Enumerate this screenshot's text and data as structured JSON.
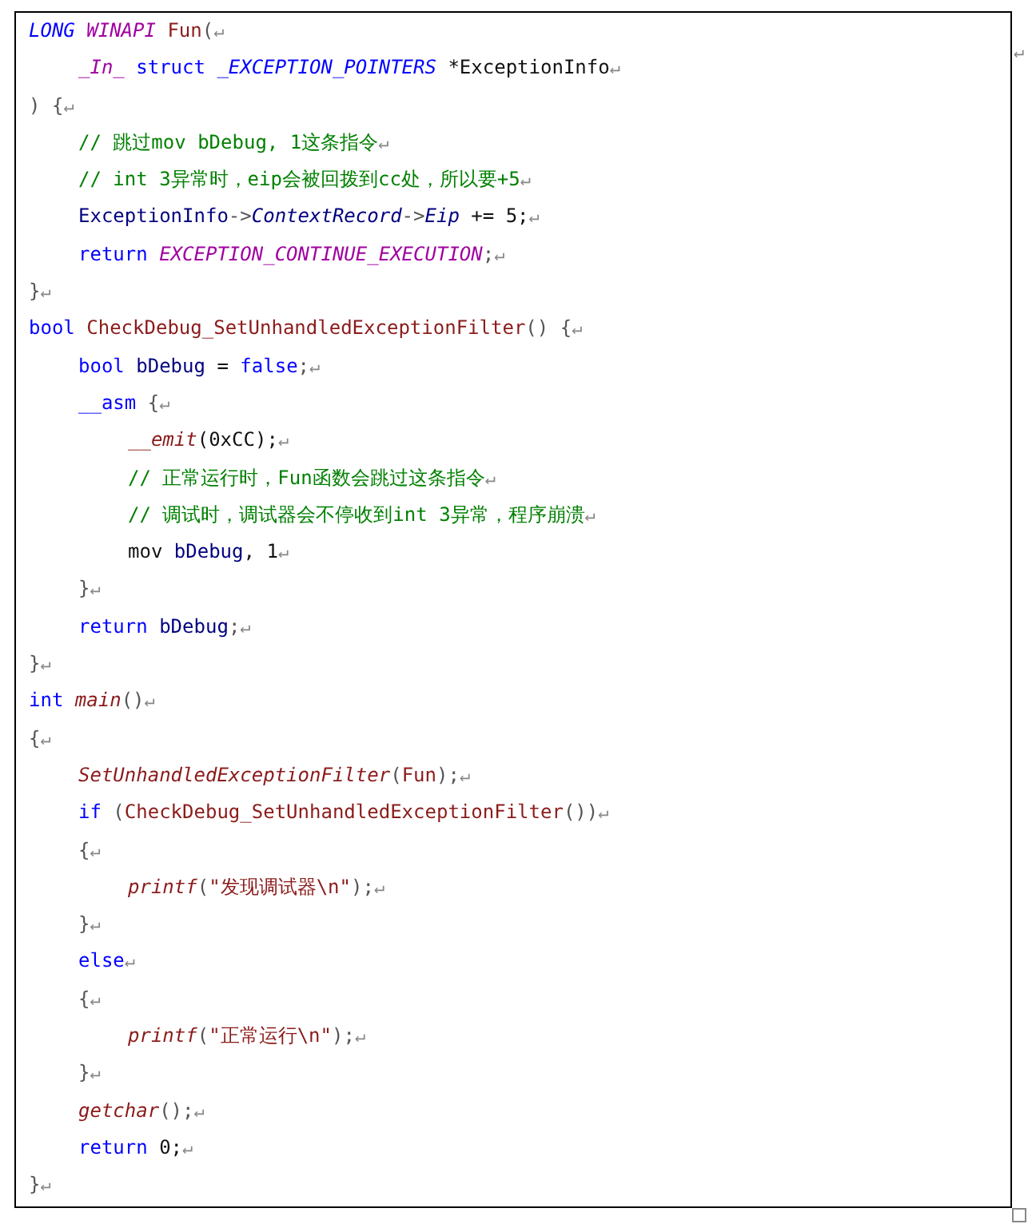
{
  "margin_mark": "↵",
  "code_block": {
    "lines": [
      {
        "tokens": [
          {
            "kind": "type",
            "text": "LONG "
          },
          {
            "kind": "macro",
            "text": "WINAPI "
          },
          {
            "kind": "func",
            "text": "Fun"
          },
          {
            "kind": "punct",
            "text": "("
          }
        ],
        "end": "↵",
        "children": [
          {
            "tokens": [
              {
                "kind": "macro",
                "text": "_In_"
              },
              {
                "kind": "keyword",
                "text": " struct"
              },
              {
                "kind": "type",
                "text": " _EXCEPTION_POINTERS"
              },
              {
                "kind": "plain",
                "text": " *ExceptionInfo"
              }
            ],
            "end": "↵"
          }
        ]
      },
      {
        "tokens": [
          {
            "kind": "punct",
            "text": ") {"
          }
        ],
        "end": "↵",
        "children": [
          {
            "tokens": [
              {
                "kind": "comment",
                "text": "// 跳过mov bDebug, 1这条指令"
              }
            ],
            "end": "↵"
          },
          {
            "tokens": [
              {
                "kind": "comment",
                "text": "// int 3异常时，eip会被回拨到cc处，所以要+5"
              }
            ],
            "end": "↵"
          },
          {
            "tokens": [
              {
                "kind": "ident",
                "text": "ExceptionInfo"
              },
              {
                "kind": "punct",
                "text": "->"
              },
              {
                "kind": "ident_italic",
                "text": "ContextRecord"
              },
              {
                "kind": "punct",
                "text": "->"
              },
              {
                "kind": "ident_italic",
                "text": "Eip"
              },
              {
                "kind": "plain",
                "text": " += 5;"
              }
            ],
            "end": "↵"
          },
          {
            "tokens": [
              {
                "kind": "keyword",
                "text": "return"
              },
              {
                "kind": "macro",
                "text": " EXCEPTION_CONTINUE_EXECUTION"
              },
              {
                "kind": "punct",
                "text": ";"
              }
            ],
            "end": "↵"
          }
        ]
      },
      {
        "tokens": [
          {
            "kind": "punct",
            "text": "}"
          }
        ],
        "end": "↵"
      },
      {
        "tokens": [
          {
            "kind": "keyword",
            "text": "bool"
          },
          {
            "kind": "func",
            "text": " CheckDebug_SetUnhandledExceptionFilter"
          },
          {
            "kind": "punct",
            "text": "() {"
          }
        ],
        "end": "↵",
        "children": [
          {
            "tokens": [
              {
                "kind": "keyword",
                "text": "bool"
              },
              {
                "kind": "ident",
                "text": " bDebug"
              },
              {
                "kind": "plain",
                "text": " = "
              },
              {
                "kind": "keyword",
                "text": "false"
              },
              {
                "kind": "punct",
                "text": ";"
              }
            ],
            "end": "↵"
          },
          {
            "tokens": [
              {
                "kind": "keyword",
                "text": "__asm"
              },
              {
                "kind": "punct",
                "text": " {"
              }
            ],
            "end": "↵",
            "children": [
              {
                "tokens": [
                  {
                    "kind": "func_italic",
                    "text": "__emit"
                  },
                  {
                    "kind": "plain",
                    "text": "(0xCC);"
                  }
                ],
                "end": "↵"
              },
              {
                "tokens": [
                  {
                    "kind": "comment",
                    "text": "// 正常运行时，Fun函数会跳过这条指令"
                  }
                ],
                "end": "↵"
              },
              {
                "tokens": [
                  {
                    "kind": "comment",
                    "text": "// 调试时，调试器会不停收到int 3异常，程序崩溃"
                  }
                ],
                "end": "↵"
              },
              {
                "tokens": [
                  {
                    "kind": "plain",
                    "text": "mov "
                  },
                  {
                    "kind": "ident",
                    "text": "bDebug"
                  },
                  {
                    "kind": "plain",
                    "text": ", 1"
                  }
                ],
                "end": "↵"
              }
            ]
          },
          {
            "tokens": [
              {
                "kind": "punct",
                "text": "}"
              }
            ],
            "end": "↵"
          },
          {
            "tokens": [
              {
                "kind": "keyword",
                "text": "return"
              },
              {
                "kind": "ident",
                "text": " bDebug"
              },
              {
                "kind": "punct",
                "text": ";"
              }
            ],
            "end": "↵"
          }
        ]
      },
      {
        "tokens": [
          {
            "kind": "punct",
            "text": "}"
          }
        ],
        "end": "↵"
      },
      {
        "tokens": [
          {
            "kind": "keyword",
            "text": "int "
          },
          {
            "kind": "func_italic",
            "text": "main"
          },
          {
            "kind": "punct",
            "text": "()"
          }
        ],
        "end": "↵"
      },
      {
        "tokens": [
          {
            "kind": "punct",
            "text": "{"
          }
        ],
        "end": "↵",
        "children": [
          {
            "tokens": [
              {
                "kind": "func_italic",
                "text": "SetUnhandledExceptionFilter"
              },
              {
                "kind": "punct",
                "text": "("
              },
              {
                "kind": "func",
                "text": "Fun"
              },
              {
                "kind": "punct",
                "text": ");"
              }
            ],
            "end": "↵"
          },
          {
            "tokens": [
              {
                "kind": "keyword",
                "text": "if"
              },
              {
                "kind": "punct",
                "text": " ("
              },
              {
                "kind": "func",
                "text": "CheckDebug_SetUnhandledExceptionFilter"
              },
              {
                "kind": "punct",
                "text": "())"
              }
            ],
            "end": "↵"
          },
          {
            "tokens": [
              {
                "kind": "punct",
                "text": "{"
              }
            ],
            "end": "↵",
            "children": [
              {
                "tokens": [
                  {
                    "kind": "func_italic",
                    "text": "printf"
                  },
                  {
                    "kind": "punct",
                    "text": "("
                  },
                  {
                    "kind": "string",
                    "text": "\"发现调试器\\n\""
                  },
                  {
                    "kind": "punct",
                    "text": ");"
                  }
                ],
                "end": "↵"
              }
            ]
          },
          {
            "tokens": [
              {
                "kind": "punct",
                "text": "}"
              }
            ],
            "end": "↵"
          },
          {
            "tokens": [
              {
                "kind": "keyword",
                "text": "else"
              }
            ],
            "end": "↵"
          },
          {
            "tokens": [
              {
                "kind": "punct",
                "text": "{"
              }
            ],
            "end": "↵",
            "children": [
              {
                "tokens": [
                  {
                    "kind": "func_italic",
                    "text": "printf"
                  },
                  {
                    "kind": "punct",
                    "text": "("
                  },
                  {
                    "kind": "string",
                    "text": "\"正常运行\\n\""
                  },
                  {
                    "kind": "punct",
                    "text": ");"
                  }
                ],
                "end": "↵"
              }
            ]
          },
          {
            "tokens": [
              {
                "kind": "punct",
                "text": "}"
              }
            ],
            "end": "↵"
          },
          {
            "tokens": [
              {
                "kind": "func_italic",
                "text": "getchar"
              },
              {
                "kind": "punct",
                "text": "();"
              }
            ],
            "end": "↵"
          },
          {
            "tokens": [
              {
                "kind": "keyword",
                "text": "return"
              },
              {
                "kind": "plain",
                "text": " 0;"
              }
            ],
            "end": "↵"
          }
        ]
      },
      {
        "tokens": [
          {
            "kind": "punct",
            "text": "}"
          }
        ],
        "end": "↵"
      }
    ]
  }
}
